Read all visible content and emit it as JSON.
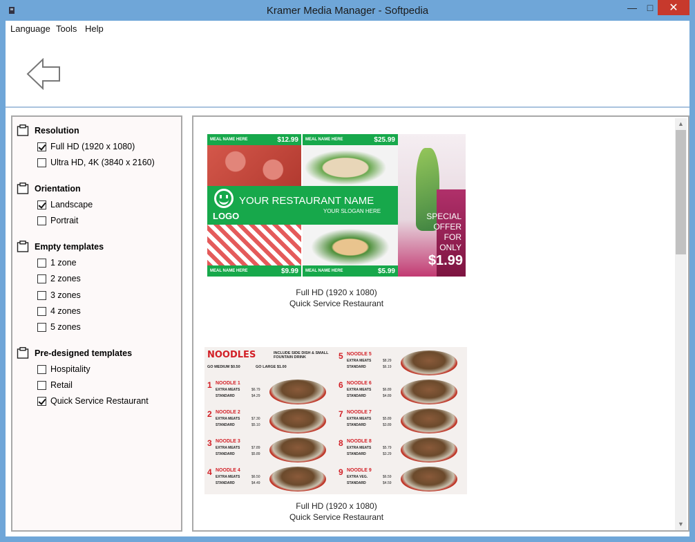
{
  "window": {
    "title": "Kramer Media Manager - Softpedia",
    "controls": {
      "minimize": "—",
      "maximize": "□",
      "close": "✕"
    }
  },
  "menu": [
    "Language",
    "Tools",
    "Help"
  ],
  "filters": {
    "groups": [
      {
        "title": "Resolution",
        "options": [
          {
            "label": "Full HD (1920 x 1080)",
            "checked": true
          },
          {
            "label": "Ultra HD, 4K (3840 x 2160)",
            "checked": false
          }
        ]
      },
      {
        "title": "Orientation",
        "options": [
          {
            "label": "Landscape",
            "checked": true
          },
          {
            "label": "Portrait",
            "checked": false
          }
        ]
      },
      {
        "title": "Empty templates",
        "options": [
          {
            "label": "1 zone",
            "checked": false
          },
          {
            "label": "2 zones",
            "checked": false
          },
          {
            "label": "3 zones",
            "checked": false
          },
          {
            "label": "4 zones",
            "checked": false
          },
          {
            "label": "5 zones",
            "checked": false
          }
        ]
      },
      {
        "title": "Pre-designed templates",
        "options": [
          {
            "label": "Hospitality",
            "checked": false
          },
          {
            "label": "Retail",
            "checked": false
          },
          {
            "label": "Quick Service Restaurant",
            "checked": true
          }
        ]
      }
    ]
  },
  "templates": [
    {
      "resolution": "Full HD (1920 x 1080)",
      "category": "Quick Service Restaurant",
      "preview": {
        "meal_label": "MEAL NAME HERE",
        "prices": [
          "$12.99",
          "$25.99",
          "$9.99",
          "$5.99"
        ],
        "restaurant_name": "YOUR RESTAURANT NAME",
        "slogan": "YOUR SLOGAN HERE",
        "logo": "LOGO",
        "offer": [
          "SPECIAL",
          "OFFER",
          "FOR",
          "ONLY"
        ],
        "offer_price": "$1.99"
      }
    },
    {
      "resolution": "Full HD (1920 x 1080)",
      "category": "Quick Service Restaurant",
      "preview": {
        "header": "NOODLES",
        "header_note": "INCLUDE SIDE DISH & SMALL FOUNTAIN DRINK",
        "go_medium": "GO MEDIUM $0.50",
        "go_large": "GO LARGE $1.00",
        "items": [
          {
            "num": "1",
            "name": "NOODLE 1",
            "opt1": "EXTRA MEATS",
            "opt2": "STANDARD",
            "p1": "$6.79",
            "p2": "$4.29"
          },
          {
            "num": "2",
            "name": "NOODLE 2",
            "opt1": "EXTRA MEATS",
            "opt2": "STANDARD",
            "p1": "$7.30",
            "p2": "$5.10"
          },
          {
            "num": "3",
            "name": "NOODLE 3",
            "opt1": "EXTRA MEATS",
            "opt2": "STANDARD",
            "p1": "$7.89",
            "p2": "$5.89"
          },
          {
            "num": "4",
            "name": "NOODLE 4",
            "opt1": "EXTRA MEATS",
            "opt2": "STANDARD",
            "p1": "$6.50",
            "p2": "$4.49"
          },
          {
            "num": "5",
            "name": "NOODLE 5",
            "opt1": "EXTRA MEATS",
            "opt2": "STANDARD",
            "p1": "$8.29",
            "p2": "$6.19"
          },
          {
            "num": "6",
            "name": "NOODLE 6",
            "opt1": "EXTRA MEATS",
            "opt2": "STANDARD",
            "p1": "$6.89",
            "p2": "$4.89"
          },
          {
            "num": "7",
            "name": "NOODLE 7",
            "opt1": "EXTRA MEATS",
            "opt2": "STANDARD",
            "p1": "$5.89",
            "p2": "$3.89"
          },
          {
            "num": "8",
            "name": "NOODLE 8",
            "opt1": "EXTRA MEATS",
            "opt2": "STANDARD",
            "p1": "$5.79",
            "p2": "$3.29"
          },
          {
            "num": "9",
            "name": "NOODLE 9",
            "opt1": "EXTRA VEG.",
            "opt2": "STANDARD",
            "p1": "$6.59",
            "p2": "$4.59"
          }
        ]
      }
    }
  ],
  "colors": {
    "frame": "#6fa6d8",
    "close": "#c7392c",
    "green": "#17a84b",
    "red": "#d21f26"
  },
  "icons": {
    "back": "arrow-left-icon",
    "group": "clipboard-icon",
    "app": "app-icon"
  }
}
